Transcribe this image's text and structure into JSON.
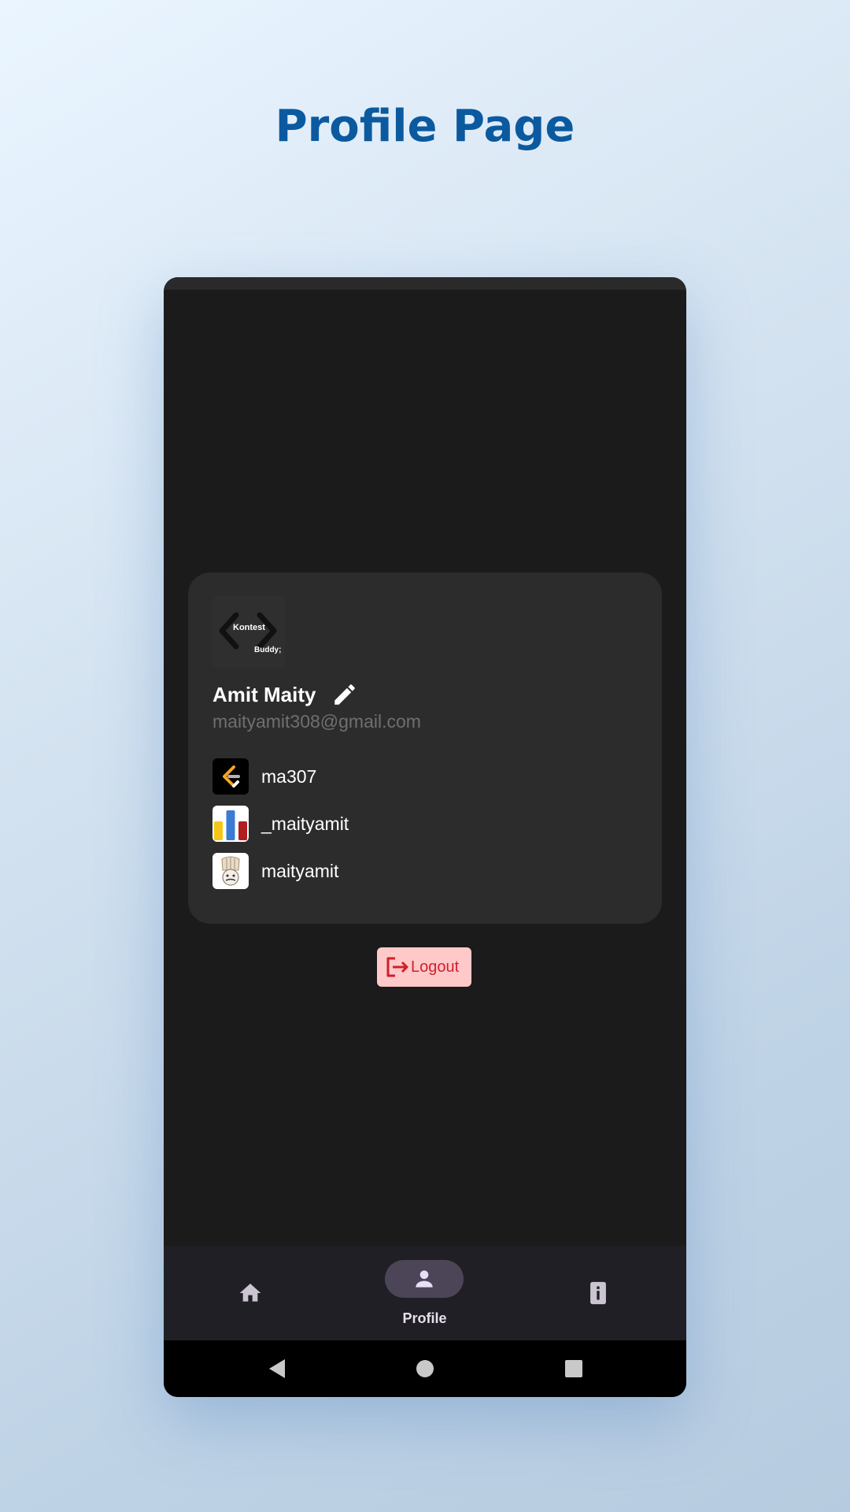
{
  "header": {
    "title": "Profile Page"
  },
  "logo": {
    "line1": "Kontest",
    "line2": "Buddy;"
  },
  "profile": {
    "name": "Amit Maity",
    "email": "maityamit308@gmail.com",
    "handles": [
      {
        "platform_icon": "leetcode-icon",
        "username": "ma307"
      },
      {
        "platform_icon": "codeforces-icon",
        "username": "_maityamit"
      },
      {
        "platform_icon": "codechef-icon",
        "username": "maityamit"
      }
    ]
  },
  "logout": {
    "label": "Logout"
  },
  "bottom_nav": {
    "items": [
      {
        "icon": "home-icon",
        "label": ""
      },
      {
        "icon": "person-icon",
        "label": "Profile"
      },
      {
        "icon": "info-icon",
        "label": ""
      }
    ],
    "active_index": 1
  },
  "colors": {
    "title": "#0b5aa0",
    "card": "#2c2c2c",
    "screen": "#1b1b1b",
    "logout_bg": "#ffc9c9",
    "logout_text": "#d11f2a",
    "nav_bg": "#211f26",
    "nav_pill": "#4b4557"
  }
}
